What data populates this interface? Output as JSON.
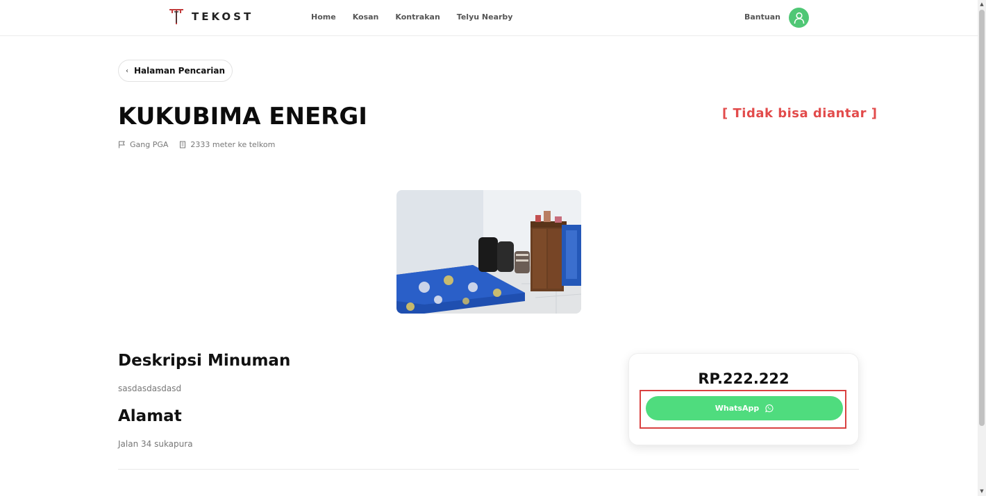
{
  "navbar": {
    "brand": "TEKOST",
    "links": [
      "Home",
      "Kosan",
      "Kontrakan",
      "Telyu Nearby"
    ],
    "help": "Bantuan"
  },
  "back": {
    "label": "Halaman Pencarian"
  },
  "listing": {
    "title": "KUKUBIMA ENERGI",
    "delivery_status": "[ Tidak bisa diantar ]",
    "location": "Gang PGA",
    "distance": "2333 meter ke telkom"
  },
  "description": {
    "heading": "Deskripsi Minuman",
    "text": "sasdasdasdasd"
  },
  "address": {
    "heading": "Alamat",
    "text": "Jalan 34 sukapura"
  },
  "price_card": {
    "price": "RP.222.222",
    "button_label": "WhatsApp"
  },
  "colors": {
    "accent_green": "#4fdc7e",
    "alert_red": "#e24b4b",
    "avatar_green": "#4fc775"
  }
}
